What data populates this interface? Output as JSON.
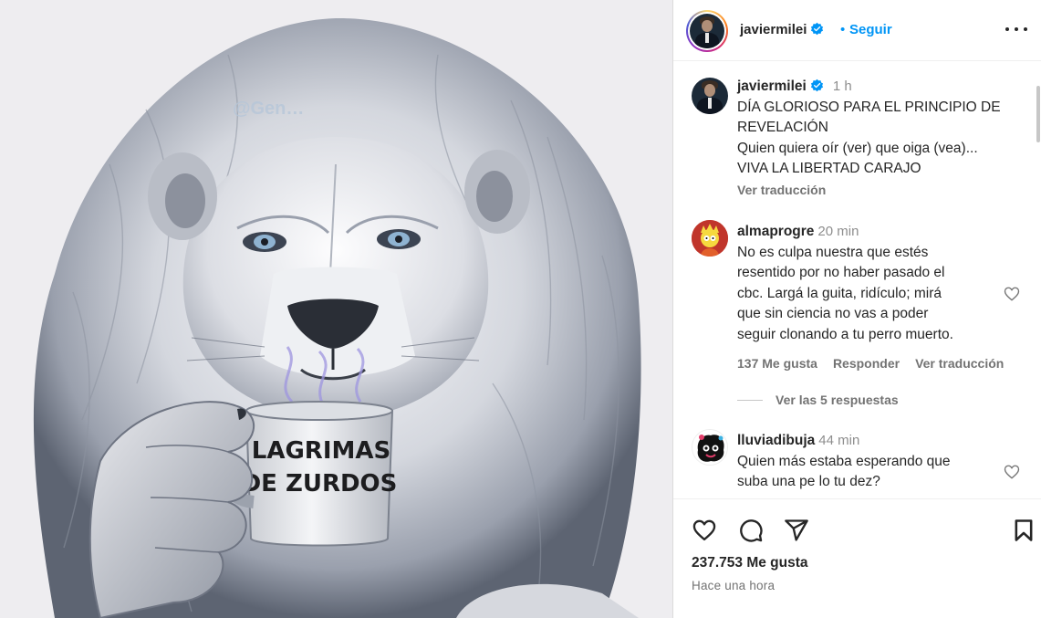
{
  "colors": {
    "accent": "#0095f6",
    "text": "#262626",
    "muted": "#737373"
  },
  "post_image": {
    "watermark": "@Gen…",
    "mug_text_line1": "LAGRIMAS",
    "mug_text_line2": "DE ZURDOS"
  },
  "header": {
    "username": "javiermilei",
    "separator": "•",
    "follow_label": "Seguir",
    "more_icon": "more-horizontal-icon",
    "verified_icon": "verified-badge-icon"
  },
  "caption": {
    "username": "javiermilei",
    "time": "1 h",
    "lines": [
      "DÍA GLORIOSO PARA EL PRINCIPIO DE",
      "REVELACIÓN",
      "Quien quiera oír (ver) que oiga (vea)...",
      "VIVA LA LIBERTAD CARAJO"
    ],
    "see_translation": "Ver traducción"
  },
  "comments": [
    {
      "username": "almaprogre",
      "time": "20 min",
      "lines": [
        "No es culpa nuestra que estés",
        "resentido por no haber pasado el",
        "cbc. Largá la guita, ridículo; mirá",
        "que sin ciencia no vas a poder",
        "seguir clonando a tu perro muerto."
      ],
      "likes": "137 Me gusta",
      "reply": "Responder",
      "see_translation": "Ver traducción",
      "view_replies": "Ver las 5 respuestas"
    },
    {
      "username": "lluviadibuja",
      "time": "44 min",
      "lines": [
        "Quien más estaba esperando que",
        "suba una pe lo tu dez?"
      ]
    }
  ],
  "actions": {
    "like_icon": "heart-icon",
    "comment_icon": "comment-icon",
    "share_icon": "share-icon",
    "save_icon": "bookmark-icon",
    "likes_count": "237.753 Me gusta",
    "posted": "Hace una hora"
  }
}
